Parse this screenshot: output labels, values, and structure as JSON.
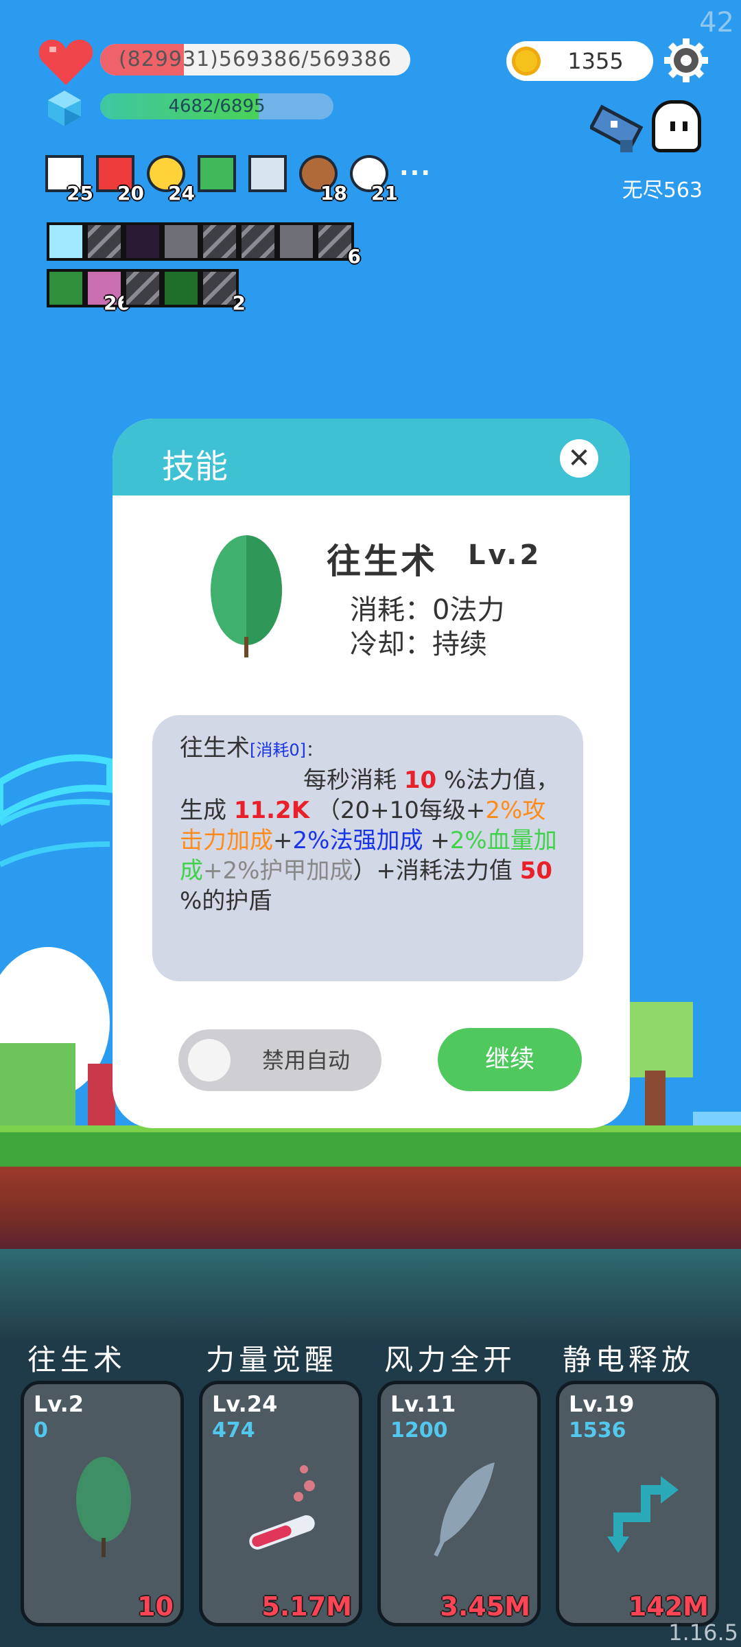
{
  "fps": "42",
  "hud": {
    "hp_text": "(829931)569386/569386",
    "hp_fill": 0.27,
    "mp_text": "4682/6895",
    "mp_fill": 0.68,
    "coins": "1355",
    "mode_label": "无尽563"
  },
  "buffs": [
    {
      "icon": "star-card-icon",
      "count": "25"
    },
    {
      "icon": "red-boot-icon",
      "count": "20"
    },
    {
      "icon": "sun-icon",
      "count": "24"
    },
    {
      "icon": "green-book-icon",
      "count": ""
    },
    {
      "icon": "sword-icon",
      "count": ""
    },
    {
      "icon": "round-shield-icon",
      "count": "18"
    },
    {
      "icon": "flower-icon",
      "count": "21"
    }
  ],
  "more_label": "···",
  "equip_row1": [
    {
      "icon": "lightbulb-slot-icon",
      "count": ""
    },
    {
      "icon": "gear-slot-icon",
      "count": ""
    },
    {
      "icon": "dark-slot-icon",
      "count": ""
    },
    {
      "icon": "armor-slot-icon",
      "count": ""
    },
    {
      "icon": "gear-slot-icon",
      "count": ""
    },
    {
      "icon": "gear-slot-icon",
      "count": ""
    },
    {
      "icon": "armor-slot-icon",
      "count": ""
    },
    {
      "icon": "gear-slot-icon",
      "count": "6"
    }
  ],
  "equip_row2": [
    {
      "icon": "clover-slot-icon",
      "count": ""
    },
    {
      "icon": "potion-slot-icon",
      "count": "26"
    },
    {
      "icon": "gear-slot-icon",
      "count": ""
    },
    {
      "icon": "green-slot-icon",
      "count": ""
    },
    {
      "icon": "gear-slot-icon",
      "count": "2"
    }
  ],
  "dialog": {
    "title": "技能",
    "close_label": "✕",
    "skill_name": "往生术",
    "skill_level": "Lv.2",
    "cost_line": "消耗：0法力",
    "cooldown_line": "冷却：持续",
    "desc": {
      "name": "往生术",
      "cost_tag": "[消耗0]",
      "colon": "：",
      "p1": "每秒消耗",
      "v1": "10",
      "p2": "%法力值，生成",
      "v2": "11.2K",
      "p3": "（20+10每级",
      "plus1": "+",
      "atk": "2%攻击力加成",
      "plus2": "+",
      "magic": "2%法强加成",
      "plus3": "+",
      "hp": "2%血量加成",
      "armor": "+2%护甲加成",
      "p4": "）+消耗法力值",
      "v3": "50",
      "p5": "%的护盾"
    },
    "auto_label": "禁用自动",
    "continue_label": "继续"
  },
  "skills": [
    {
      "name": "往生术",
      "level": "Lv.2",
      "mana": "0",
      "icon": "leaf-icon",
      "cost": "10"
    },
    {
      "name": "力量觉醒",
      "level": "Lv.24",
      "mana": "474",
      "icon": "potion-tube-icon",
      "cost": "5.17M"
    },
    {
      "name": "风力全开",
      "level": "Lv.11",
      "mana": "1200",
      "icon": "feather-icon",
      "cost": "3.45M"
    },
    {
      "name": "静电释放",
      "level": "Lv.19",
      "mana": "1536",
      "icon": "zigzag-arrow-icon",
      "cost": "142M"
    }
  ],
  "version": "1.16.5",
  "colors": {
    "accent": "#3dc1d3",
    "continue": "#4fc95d",
    "hp": "#f0626a",
    "cost_red": "#e8202a"
  }
}
